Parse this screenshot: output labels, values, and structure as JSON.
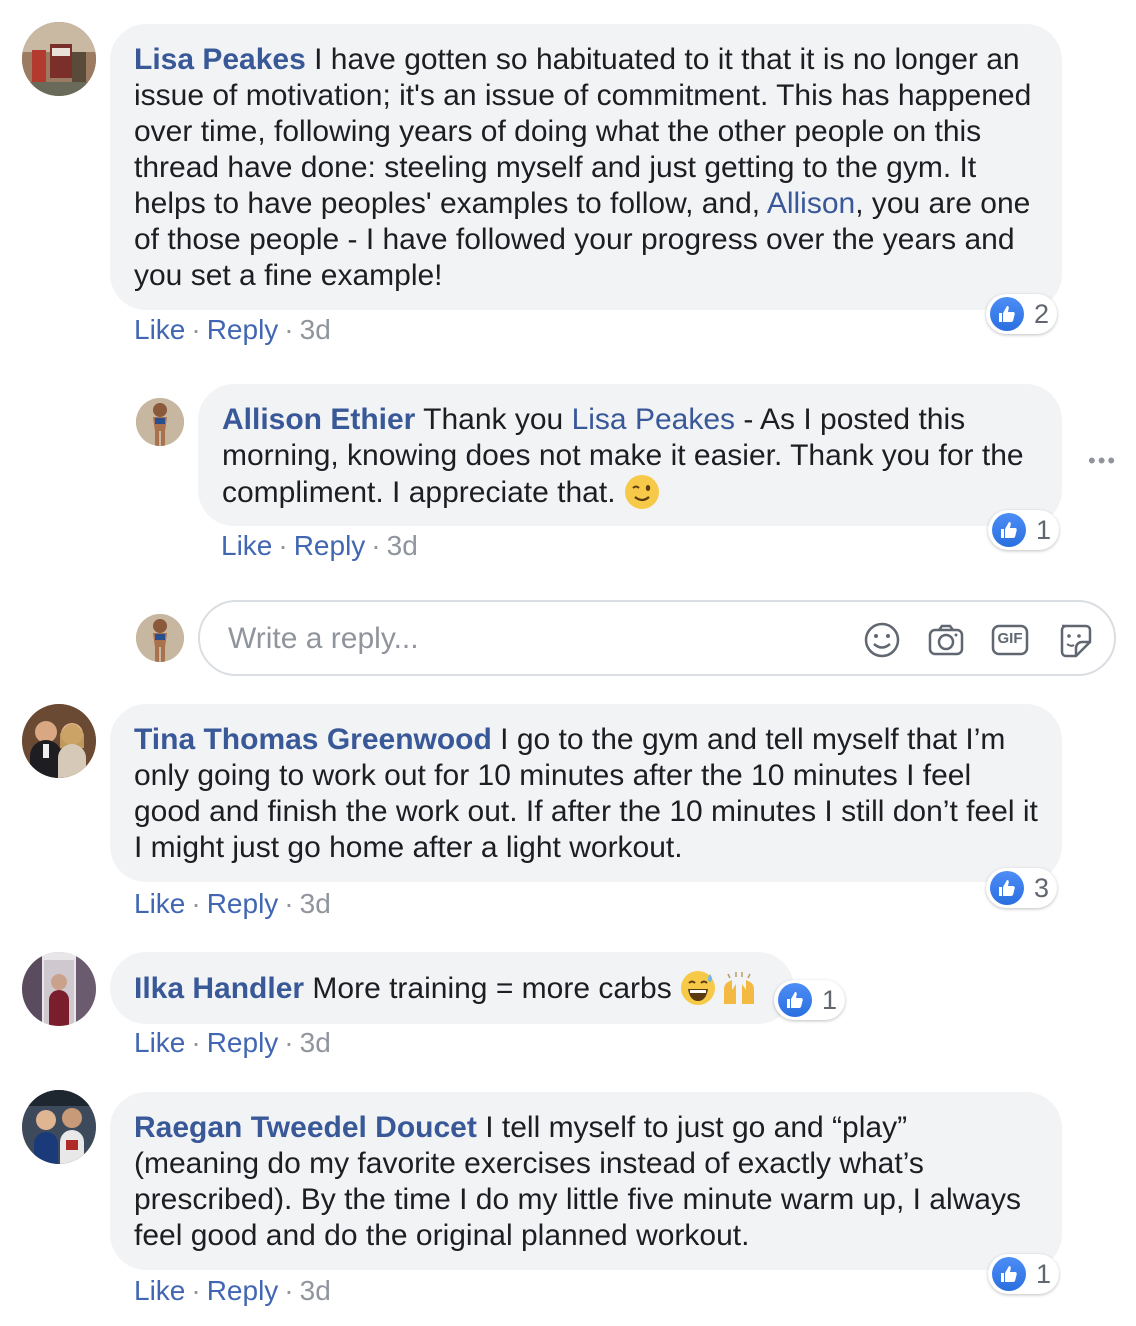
{
  "comments": [
    {
      "author": "Lisa Peakes",
      "text_before": " I have gotten so habituated to it that it is no longer an issue of motivation; it's an issue of commitment. This has happened over time, following years of doing what the other people on this thread have done: steeling myself and just getting to the gym. It helps to have peoples' examples to follow, and, ",
      "mention": "Allison",
      "text_after": ", you are one of those people - I have followed your progress over the years and you set a fine example!",
      "reaction_count": "2",
      "like": "Like",
      "reply": "Reply",
      "time": "3d"
    },
    {
      "author": "Allison Ethier",
      "text_before": " Thank you ",
      "mention": "Lisa Peakes",
      "text_after": " - As I posted this morning, knowing does not make it easier. Thank you for the compliment. I appreciate that. ",
      "emoji": "wink",
      "reaction_count": "1",
      "like": "Like",
      "reply": "Reply",
      "time": "3d"
    },
    {
      "author": "Tina Thomas Greenwood",
      "text": " I go to the gym and tell myself that I’m only going to work out for 10 minutes after the 10 minutes I feel good and finish the work out. If after the 10 minutes I still don’t feel it I might just go home after a light workout.",
      "reaction_count": "3",
      "like": "Like",
      "reply": "Reply",
      "time": "3d"
    },
    {
      "author": "Ilka Handler",
      "text": " More training = more carbs ",
      "emojis": [
        "grinning-sweat",
        "raised-hands"
      ],
      "reaction_count": "1",
      "like": "Like",
      "reply": "Reply",
      "time": "3d"
    },
    {
      "author": "Raegan Tweedel Doucet",
      "text": " I tell myself to just go and “play” (meaning do my favorite exercises instead of exactly what’s prescribed). By the time I do my little five minute warm up, I always feel good and do the original planned workout.",
      "reaction_count": "1",
      "like": "Like",
      "reply": "Reply",
      "time": "3d"
    }
  ],
  "reply_box": {
    "placeholder": "Write a reply...",
    "icons": [
      "smiley-icon",
      "camera-icon",
      "gif-icon",
      "sticker-icon"
    ],
    "gif_label": "GIF"
  },
  "separator": "·",
  "more_options": "•••",
  "colors": {
    "link": "#385898",
    "bubble": "#f2f3f5",
    "like_blue": "#2a6fe0",
    "meta_grey": "#90949c"
  }
}
